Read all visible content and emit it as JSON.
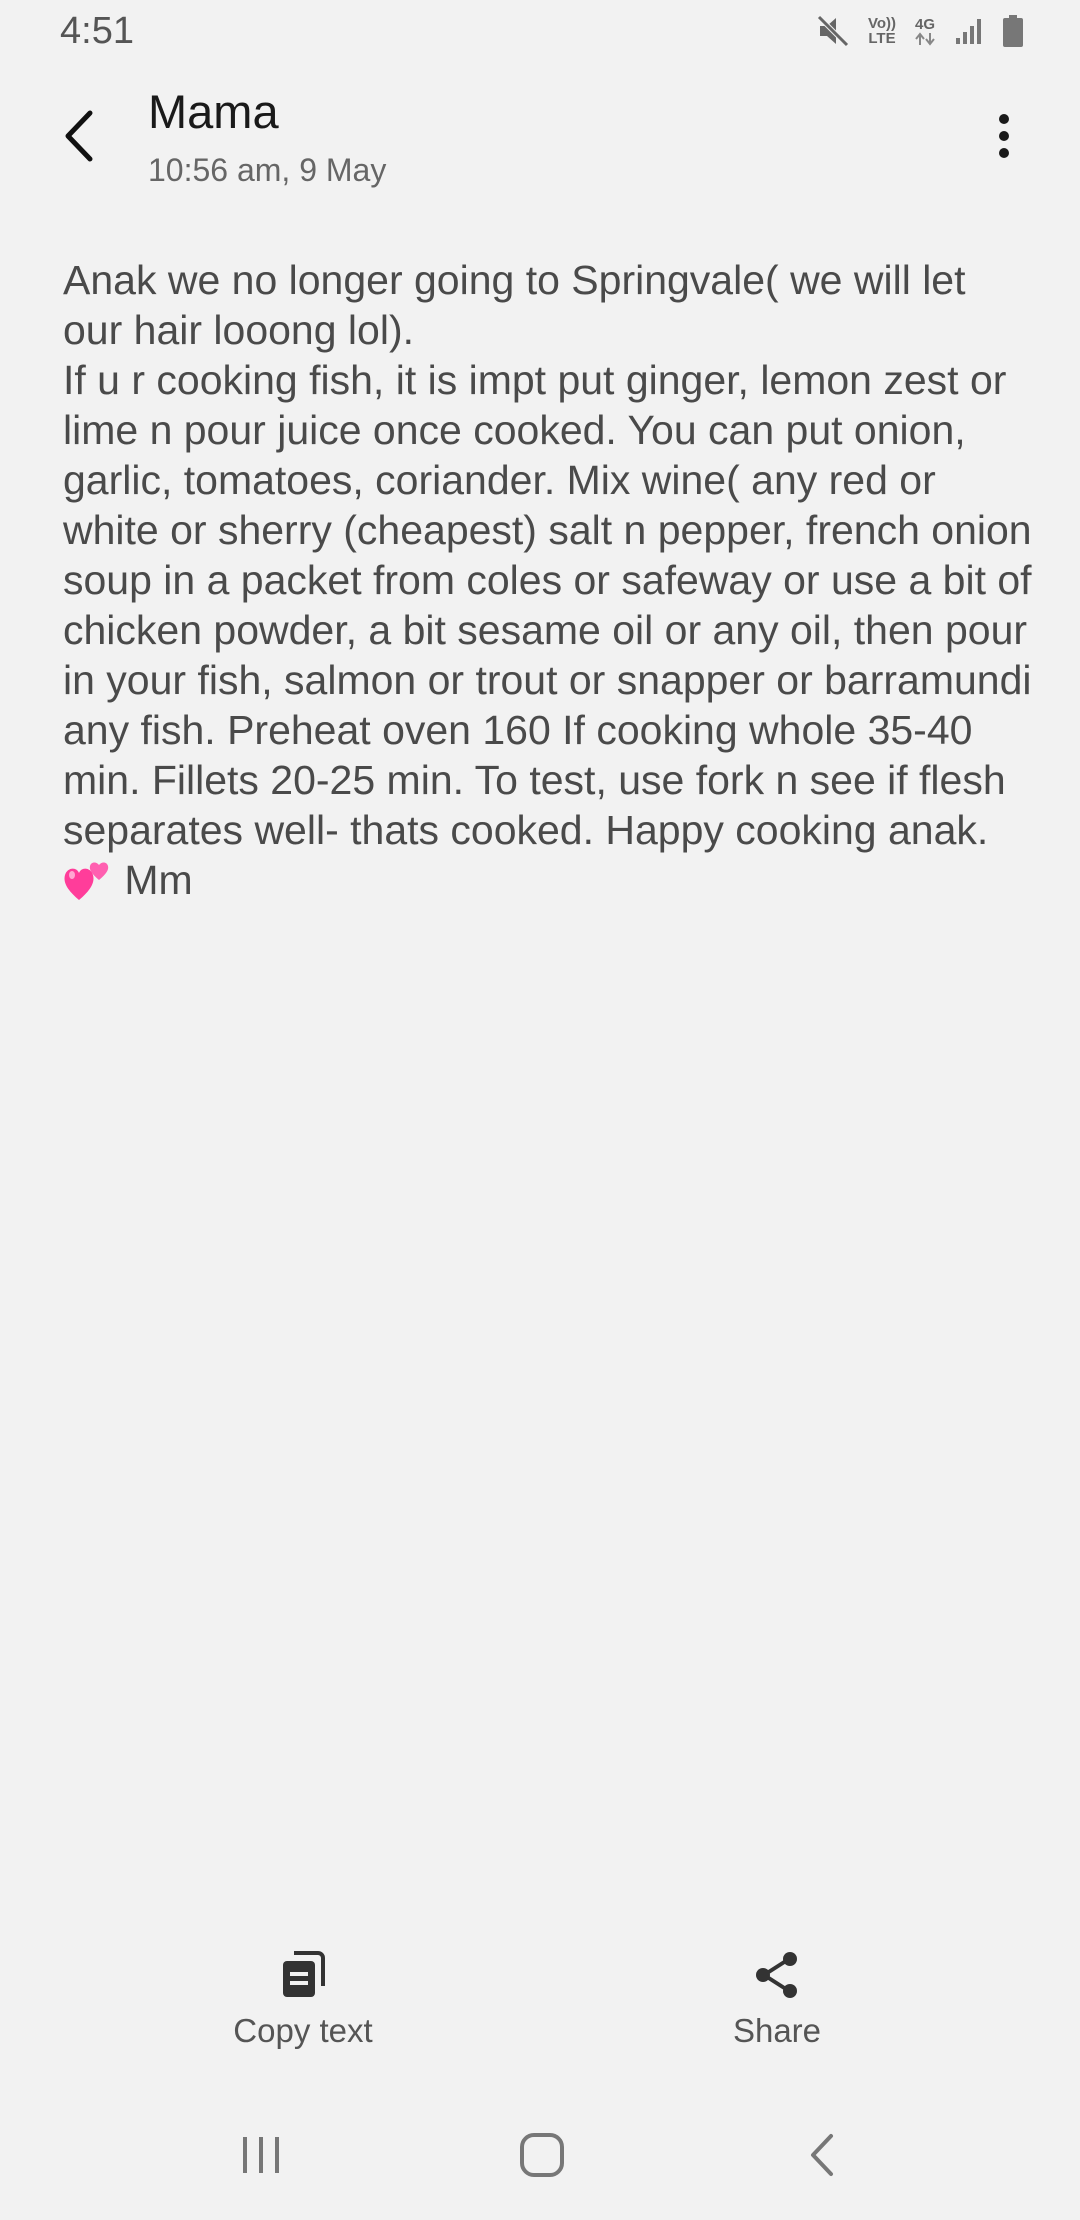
{
  "status_bar": {
    "time": "4:51",
    "icons": [
      "mute-icon",
      "volte-icon",
      "4g-icon",
      "signal-icon",
      "battery-icon"
    ],
    "volte_line1": "Vo))",
    "volte_line2": "LTE",
    "network": "4G"
  },
  "header": {
    "sender": "Mama",
    "timestamp": "10:56 am, 9 May"
  },
  "message": {
    "text_main": "Anak we no longer going to Springvale( we will let our hair looong lol).\nIf u r cooking fish, it is impt put ginger, lemon zest or lime n pour juice once cooked. You can put onion, garlic, tomatoes, coriander. Mix wine( any red or white or sherry (cheapest) salt n pepper, french onion soup in a packet from coles or safeway or use a bit of chicken powder, a bit sesame oil or any oil, then pour in your fish, salmon or trout or snapper or barramundi any fish. Preheat oven 160 If cooking whole 35-40 min. Fillets 20-25 min. To test, use fork n see if flesh separates well- thats cooked. Happy cooking anak. ",
    "emoji": "two-hearts-emoji",
    "signoff": " Mm"
  },
  "actions": {
    "copy_label": "Copy text",
    "share_label": "Share"
  },
  "colors": {
    "background": "#f2f2f2",
    "text": "#4a4a4a",
    "heart": "#ff3d9a"
  }
}
